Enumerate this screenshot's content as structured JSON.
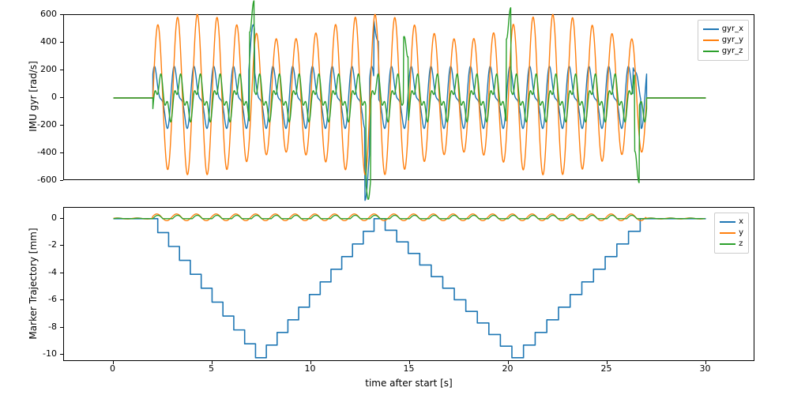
{
  "colors": {
    "c1": "#1f77b4",
    "c2": "#ff7f0e",
    "c3": "#2ca02c"
  },
  "xlabel": "time after start [s]",
  "top": {
    "ylabel": "IMU gyr [rad/s]",
    "ylim": [
      -600,
      600
    ],
    "xlim": [
      -2.5,
      32.5
    ],
    "yticks": [
      -600,
      -400,
      -200,
      0,
      200,
      400,
      600
    ],
    "xticks": [
      0,
      5,
      10,
      15,
      20,
      25,
      30
    ],
    "legend": [
      "gyr_x",
      "gyr_y",
      "gyr_z"
    ]
  },
  "bottom": {
    "ylabel": "Marker Trajectory [mm]",
    "ylim": [
      -10.5,
      0.8
    ],
    "xlim": [
      -2.5,
      32.5
    ],
    "yticks": [
      -10,
      -8,
      -6,
      -4,
      -2,
      0
    ],
    "xticks": [
      0,
      5,
      10,
      15,
      20,
      25,
      30
    ],
    "legend": [
      "x",
      "y",
      "z"
    ]
  },
  "chart_data": [
    {
      "type": "line",
      "title": "",
      "xlabel": "time after start [s]",
      "ylabel": "IMU gyr [rad/s]",
      "xlim": [
        -2.5,
        32.5
      ],
      "ylim": [
        -600,
        650
      ],
      "x_range_s": [
        0,
        30
      ],
      "active_window_s": [
        2,
        27
      ],
      "approx_cycle_period_s": 1.0,
      "series": [
        {
          "name": "gyr_x",
          "color": "#1f77b4",
          "peak_to_peak_approx": [
            -300,
            350
          ],
          "notable_spikes": [
            {
              "t": 7,
              "v": 370
            },
            {
              "t": 12.8,
              "v": -500
            },
            {
              "t": 13.3,
              "v": 420
            },
            {
              "t": 26.5,
              "v": 250
            }
          ],
          "baseline_outside_active": 0
        },
        {
          "name": "gyr_y",
          "color": "#ff7f0e",
          "peak_to_peak_approx": [
            -500,
            650
          ],
          "n_cycles_approx": 25,
          "baseline_outside_active": 0
        },
        {
          "name": "gyr_z",
          "color": "#2ca02c",
          "peak_to_peak_approx": [
            -150,
            200
          ],
          "notable_spikes": [
            {
              "t": 7,
              "v": 680
            },
            {
              "t": 12.9,
              "v": -570
            },
            {
              "t": 14.8,
              "v": 500
            },
            {
              "t": 20,
              "v": 630
            },
            {
              "t": 26.5,
              "v": -560
            }
          ],
          "baseline_outside_active": 0
        }
      ]
    },
    {
      "type": "line",
      "title": "",
      "xlabel": "time after start [s]",
      "ylabel": "Marker Trajectory [mm]",
      "xlim": [
        -2.5,
        32.5
      ],
      "ylim": [
        -10.5,
        0.8
      ],
      "series": [
        {
          "name": "x",
          "color": "#1f77b4",
          "keypoints": [
            [
              0,
              0
            ],
            [
              2,
              0
            ],
            [
              7.5,
              -10.2
            ],
            [
              13.5,
              0
            ],
            [
              20.5,
              -10.2
            ],
            [
              27,
              0
            ],
            [
              30,
              0
            ]
          ],
          "shape": "two staircase-like V descents with ~10 steps each side"
        },
        {
          "name": "y",
          "color": "#ff7f0e",
          "range_approx": [
            -0.3,
            0.5
          ],
          "baseline": 0
        },
        {
          "name": "z",
          "color": "#2ca02c",
          "range_approx": [
            -0.3,
            0.5
          ],
          "baseline": 0,
          "shape": "small periodic bumps synced with steps"
        }
      ]
    }
  ]
}
